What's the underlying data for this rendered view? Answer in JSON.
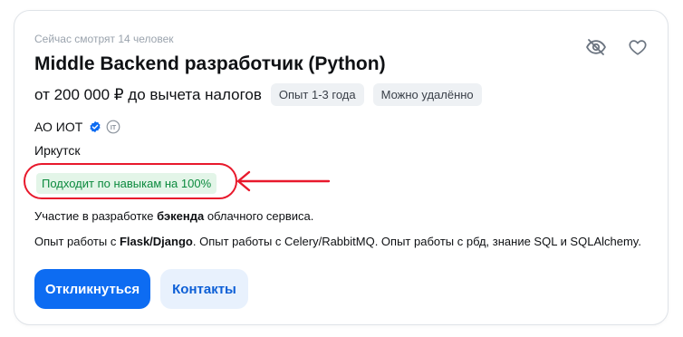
{
  "watchers_text": "Сейчас смотрят 14 человек",
  "icons": {
    "hide": "eye-off-icon",
    "favorite": "heart-icon",
    "verified": "verified-check-icon",
    "accredited_it": "it-accreditation-icon",
    "arrow": "red-arrow-annotation"
  },
  "vacancy": {
    "title": "Middle Backend разработчик (Python)",
    "salary": "от 200 000 ₽ до вычета налогов",
    "tags": [
      "Опыт 1-3 года",
      "Можно удалённо"
    ],
    "company": "АО ИОТ",
    "it_badge_text": "IT",
    "city": "Иркутск",
    "match_text": "Подходит по навыкам на 100%",
    "description_1": {
      "before": "Участие в разработке ",
      "bold": "бэкенда",
      "after": " облачного сервиса."
    },
    "description_2": {
      "p1": "Опыт работы с ",
      "b1": "Flask/Django",
      "p2": ". Опыт работы с Celery/RabbitMQ. Опыт работы с рбд, знание SQL и SQLAlchemy."
    }
  },
  "buttons": {
    "respond": "Откликнуться",
    "contacts": "Контакты"
  },
  "colors": {
    "primary": "#0d6cf2",
    "secondary_bg": "#e8f1fd",
    "match_bg": "#e3f5e8",
    "match_text": "#0c8a3e",
    "annotation_red": "#e8192c"
  }
}
